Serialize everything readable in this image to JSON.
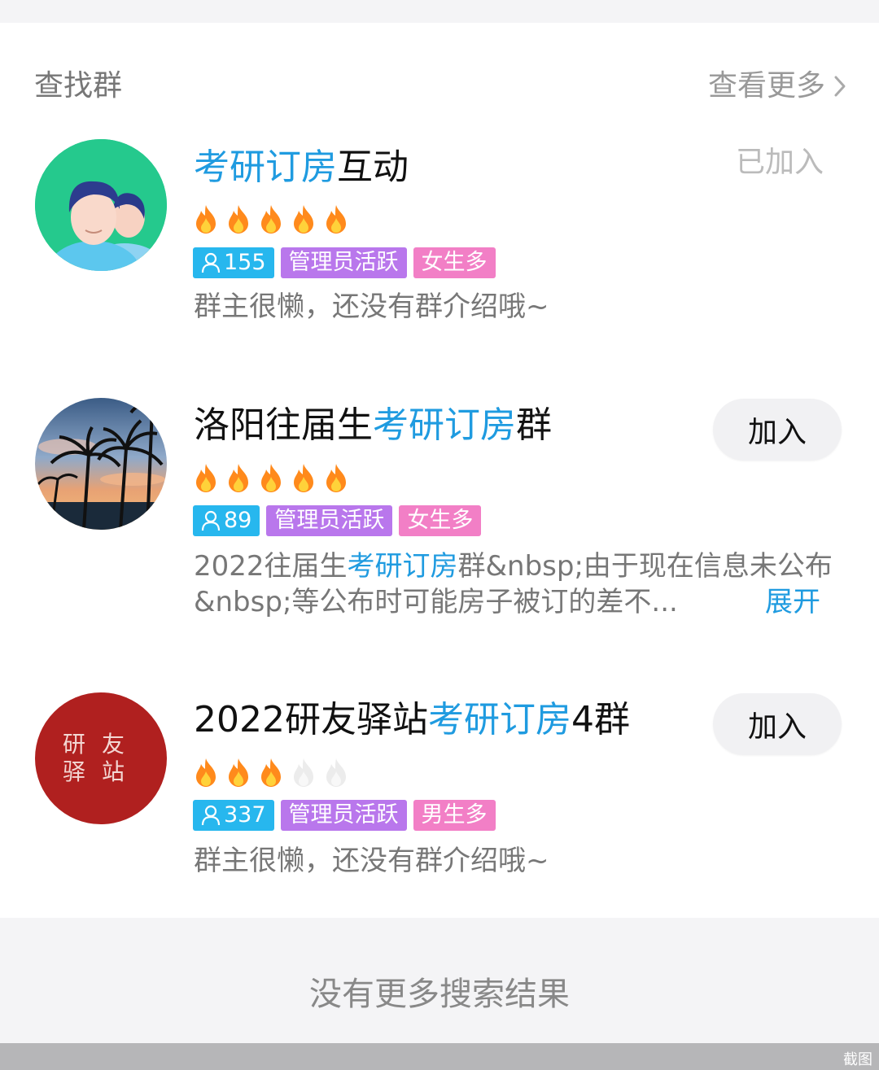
{
  "header": {
    "title": "查找群",
    "more_label": "查看更多"
  },
  "groups": [
    {
      "name_highlight": "考研订房",
      "name_rest": "互动",
      "flames_lit": 5,
      "members": "155",
      "tag_admin": "管理员活跃",
      "tag_gender": "女生多",
      "desc": "群主很懒，还没有群介绍哦~",
      "status": "已加入"
    },
    {
      "name_prefix": "洛阳往届生",
      "name_highlight": "考研订房",
      "name_suffix": "群",
      "flames_lit": 5,
      "members": "89",
      "tag_admin": "管理员活跃",
      "tag_gender": "女生多",
      "desc_prefix": "2022往届生",
      "desc_highlight": "考研订房",
      "desc_rest": "群&nbsp;由于现在信息未公布&nbsp;等公布时可能房子被订的差不...",
      "expand": "展开",
      "join_label": "加入"
    },
    {
      "name_prefix": "2022研友驿站",
      "name_highlight": "考研订房",
      "name_suffix": "4群",
      "flames_lit": 3,
      "members": "337",
      "tag_admin": "管理员活跃",
      "tag_gender": "男生多",
      "desc": "群主很懒，还没有群介绍哦~",
      "join_label": "加入",
      "avatar_text": [
        "研",
        "友",
        "驿",
        "站"
      ]
    }
  ],
  "footer": {
    "text": "没有更多搜索结果"
  },
  "bottom_bar": {
    "label": "截图"
  },
  "colors": {
    "highlight": "#1f9be0",
    "members_tag": "#27b7ee",
    "admin_tag": "#b977ec",
    "gender_tag": "#f27fc6"
  }
}
